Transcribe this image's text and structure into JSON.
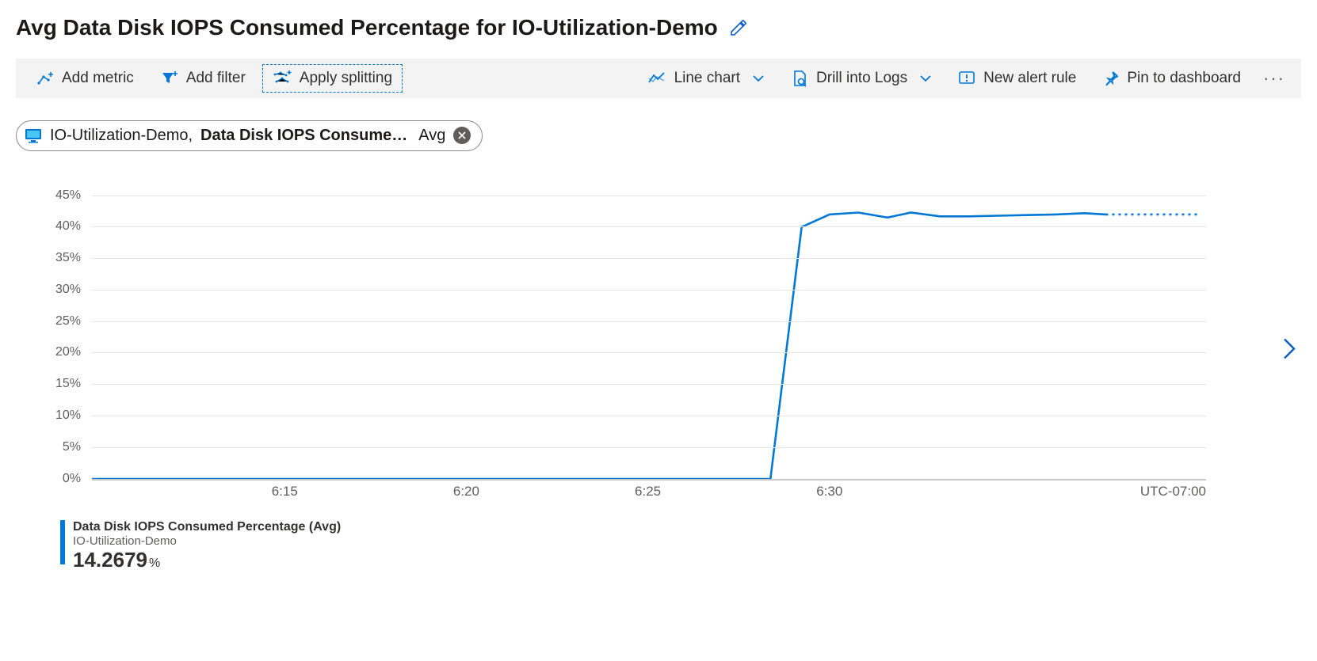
{
  "title": "Avg Data Disk IOPS Consumed Percentage for IO-Utilization-Demo",
  "toolbar": {
    "add_metric": "Add metric",
    "add_filter": "Add filter",
    "apply_splitting": "Apply splitting",
    "line_chart": "Line chart",
    "drill_logs": "Drill into Logs",
    "new_alert": "New alert rule",
    "pin_dashboard": "Pin to dashboard"
  },
  "metric_chip": {
    "resource": "IO-Utilization-Demo,",
    "metric": "Data Disk IOPS Consume…",
    "aggregation": "Avg"
  },
  "legend": {
    "line1": "Data Disk IOPS Consumed Percentage (Avg)",
    "line2": "IO-Utilization-Demo",
    "value": "14.2679",
    "unit": "%"
  },
  "timezone": "UTC-07:00",
  "chart_data": {
    "type": "line",
    "title": "Avg Data Disk IOPS Consumed Percentage for IO-Utilization-Demo",
    "xlabel": "",
    "ylabel": "",
    "ylim": [
      0,
      45
    ],
    "y_ticks": [
      0,
      5,
      10,
      15,
      20,
      25,
      30,
      35,
      40,
      45
    ],
    "y_tick_labels": [
      "0%",
      "5%",
      "10%",
      "15%",
      "20%",
      "25%",
      "30%",
      "35%",
      "40%",
      "45%"
    ],
    "x_ticks": [
      "6:15",
      "6:20",
      "6:25",
      "6:30"
    ],
    "x_tick_positions_pct": [
      17.3,
      33.6,
      49.9,
      66.2
    ],
    "timezone": "UTC-07:00",
    "series": [
      {
        "name": "Data Disk IOPS Consumed Percentage (Avg) — IO-Utilization-Demo",
        "color": "#0078d4",
        "x_pct": [
          0,
          5,
          10,
          15,
          17.3,
          20,
          25,
          30,
          33.6,
          35,
          40,
          45,
          49.9,
          55,
          60,
          60.9,
          63.7,
          66.2,
          68.8,
          71.4,
          73.5,
          76.1,
          78.7,
          81.3,
          83.9,
          86.5,
          89.1,
          91.0
        ],
        "values": [
          0,
          0,
          0,
          0,
          0,
          0,
          0,
          0,
          0,
          0,
          0,
          0,
          0,
          0,
          0,
          0,
          40,
          42,
          42.3,
          41.5,
          42.3,
          41.7,
          41.7,
          41.8,
          41.9,
          42.0,
          42.2,
          42.0
        ],
        "forecast_x_pct": [
          91.0,
          93.0,
          95.0,
          97.0,
          99.5
        ],
        "forecast_values": [
          42.0,
          42.0,
          42.0,
          42.0,
          42.0
        ]
      }
    ],
    "summary_value": 14.2679,
    "summary_unit": "%"
  }
}
